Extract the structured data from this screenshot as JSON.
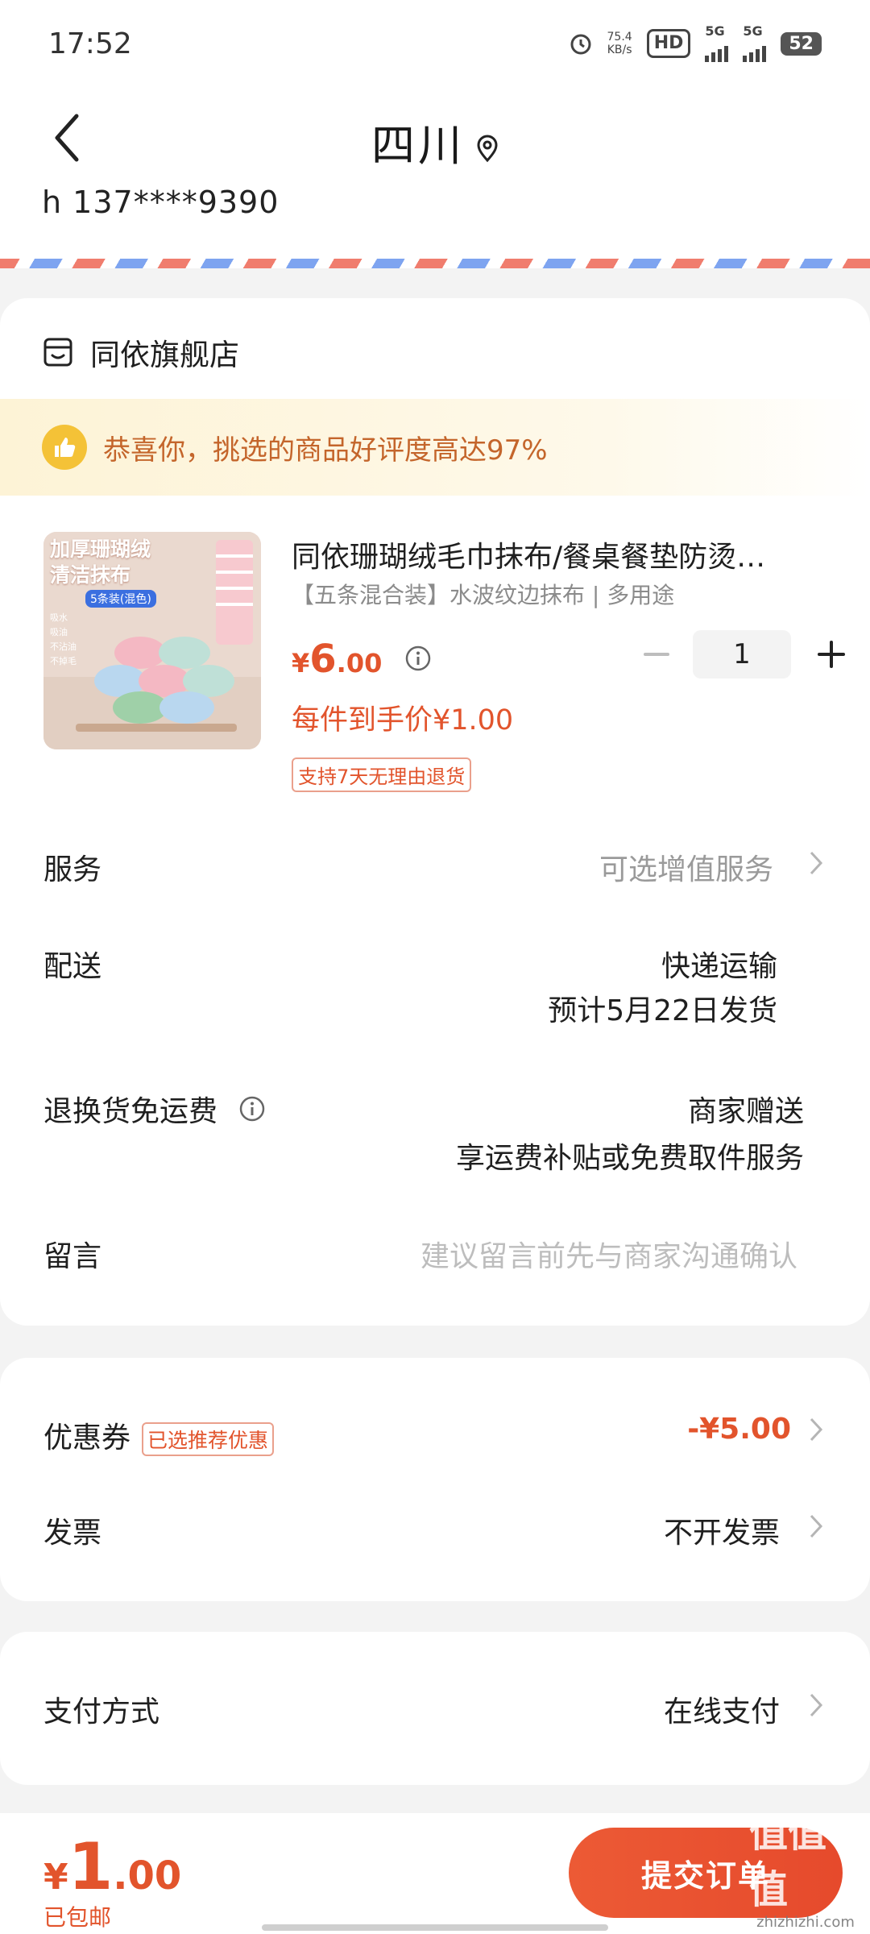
{
  "status_bar": {
    "time": "17:52",
    "net_speed_value": "75.4",
    "net_speed_unit": "KB/s",
    "hd_label": "HD",
    "sim1_label": "5G",
    "sim2_label": "5G",
    "battery": "52"
  },
  "header": {
    "title": "四川",
    "phone": "h  137****9390"
  },
  "store": {
    "name": "同依旗舰店",
    "promo_text": "恭喜你，挑选的商品好评度高达97%"
  },
  "product": {
    "image_line1": "加厚珊瑚绒",
    "image_line2": "清洁抹布",
    "image_tag": "5条装(混色)",
    "image_bullets": [
      "吸水",
      "吸油",
      "不沾油",
      "不掉毛"
    ],
    "title": "同依珊瑚绒毛巾抹布/餐桌餐垫防烫…",
    "spec": "【五条混合装】水波纹边抹布 | 多用途",
    "price_yen": "¥",
    "price_int": "6",
    "price_dec": ".00",
    "quantity": "1",
    "unit_price": "每件到手价¥1.00",
    "return_badge": "支持7天无理由退货"
  },
  "rows": {
    "service_label": "服务",
    "service_value": "可选增值服务",
    "delivery_label": "配送",
    "delivery_method": "快递运输",
    "delivery_date": "预计5月22日发货",
    "return_label": "退换货免运费",
    "return_value1": "商家赠送",
    "return_value2": "享运费补贴或免费取件服务",
    "message_label": "留言",
    "message_placeholder": "建议留言前先与商家沟通确认"
  },
  "coupon": {
    "label": "优惠券",
    "tag": "已选推荐优惠",
    "value": "-¥5.00",
    "invoice_label": "发票",
    "invoice_value": "不开发票"
  },
  "payment": {
    "label": "支付方式",
    "value": "在线支付"
  },
  "bottom": {
    "total_yen": "¥",
    "total_int": "1",
    "total_dec": ".00",
    "shipping_note": "已包邮",
    "submit_label": "提交订单",
    "watermark": "值值值",
    "watermark_url": "zhizhizhi.com"
  },
  "colors": {
    "accent": "#e2542c",
    "promo_text": "#c4652b",
    "thumb_icon": "#f4c237"
  },
  "icons": [
    "back-arrow-icon",
    "location-pin-icon",
    "store-icon",
    "thumbs-up-icon",
    "info-icon",
    "minus-icon",
    "plus-icon",
    "chevron-right-icon"
  ]
}
